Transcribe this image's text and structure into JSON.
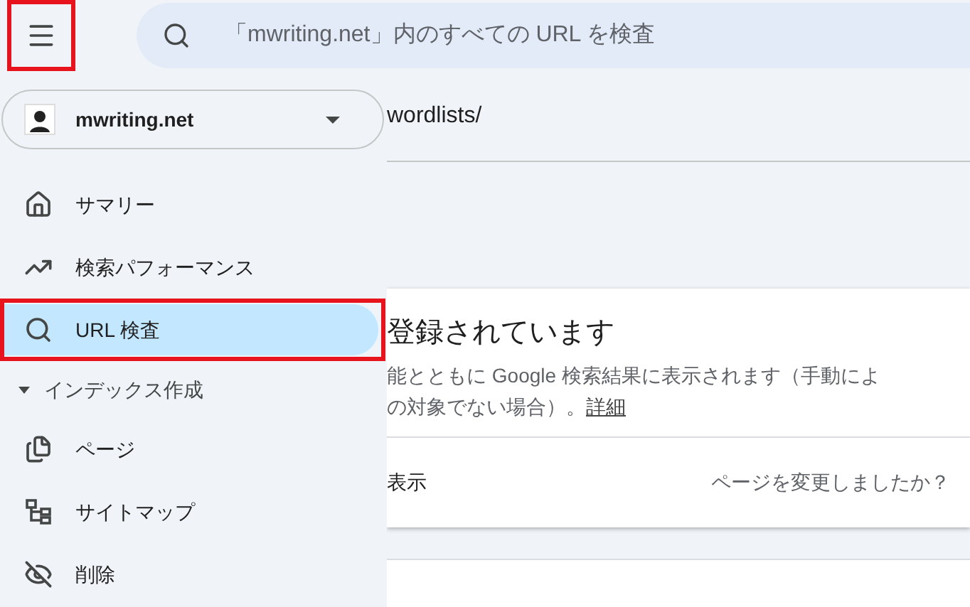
{
  "header": {
    "menu_button": {
      "highlighted": true
    },
    "search": {
      "placeholder": "「mwriting.net」内のすべての URL を検査"
    }
  },
  "property": {
    "name": "mwriting.net"
  },
  "url_path": "wordlists/",
  "nav": [
    {
      "kind": "item",
      "label": "サマリー",
      "selected": false,
      "highlighted": false
    },
    {
      "kind": "item",
      "label": "検索パフォーマンス",
      "selected": false,
      "highlighted": false
    },
    {
      "kind": "item",
      "label": "URL 検査",
      "selected": true,
      "highlighted": true
    },
    {
      "kind": "section",
      "label": "インデックス作成",
      "expanded": true
    },
    {
      "kind": "item",
      "label": "ページ",
      "selected": false,
      "highlighted": false
    },
    {
      "kind": "item",
      "label": "サイトマップ",
      "selected": false,
      "highlighted": false
    },
    {
      "kind": "item",
      "label": "削除",
      "selected": false,
      "highlighted": false
    }
  ],
  "card": {
    "title": "登録されています",
    "description_line_1": "能とともに Google 検索結果に表示されます（手動によ",
    "description_line_2": "の対象でない場合）。",
    "details_link": "詳細",
    "footer_left": "表示",
    "footer_right": "ページを変更しましたか？"
  }
}
